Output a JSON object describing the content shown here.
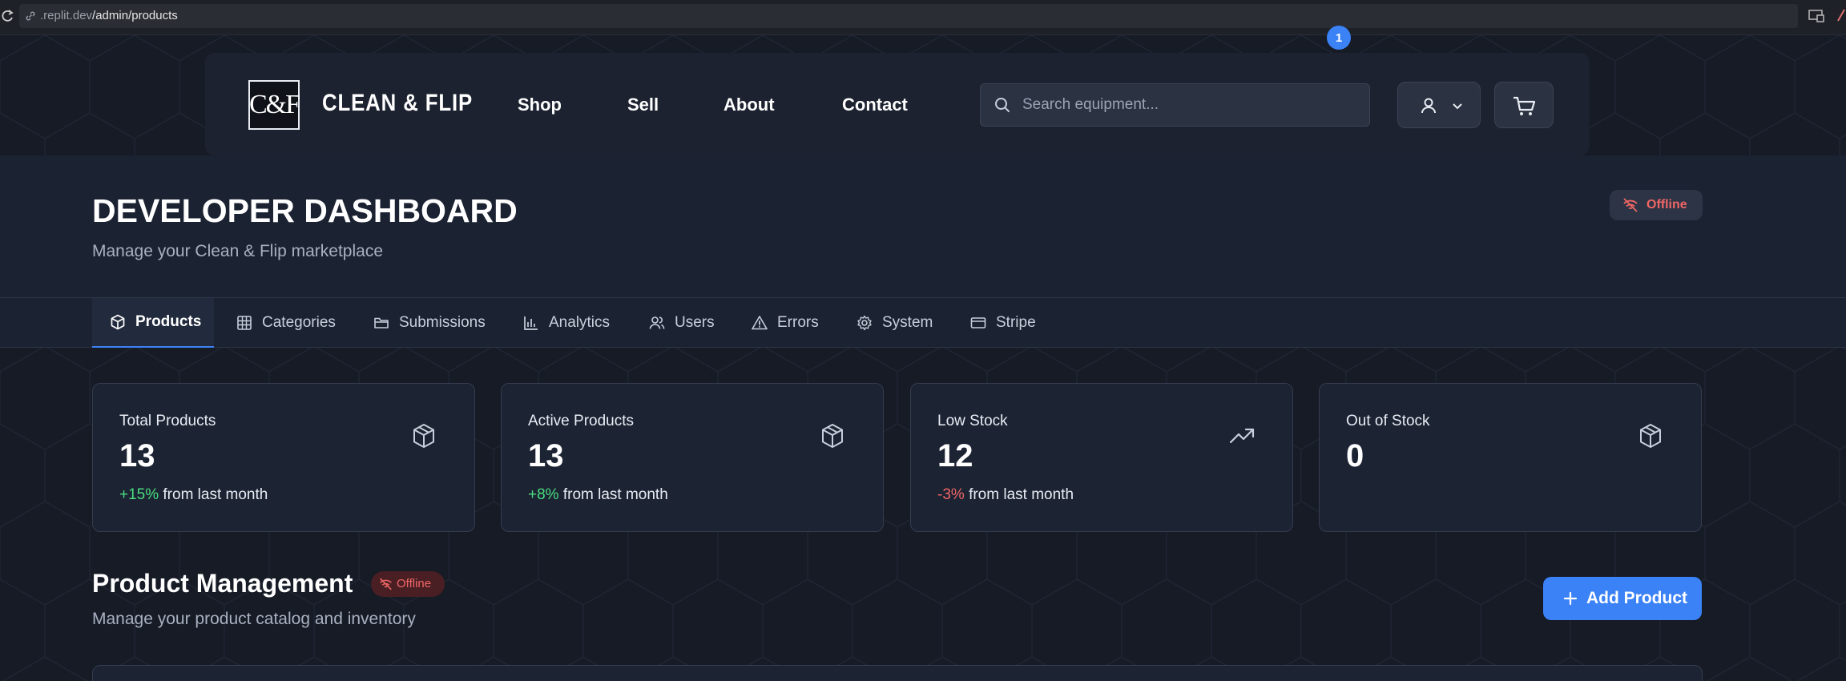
{
  "browser": {
    "url_host": ".replit.dev",
    "url_path": "/admin/products"
  },
  "header": {
    "logo_text": "C&F",
    "brand": "CLEAN & FLIP",
    "nav": [
      "Shop",
      "Sell",
      "About",
      "Contact"
    ],
    "search_placeholder": "Search equipment...",
    "cart_count": "1"
  },
  "dashboard": {
    "title": "DEVELOPER DASHBOARD",
    "subtitle": "Manage your Clean & Flip marketplace",
    "status": "Offline"
  },
  "tabs": [
    {
      "label": "Products",
      "icon": "package-icon",
      "active": true
    },
    {
      "label": "Categories",
      "icon": "grid-icon",
      "active": false
    },
    {
      "label": "Submissions",
      "icon": "folder-icon",
      "active": false
    },
    {
      "label": "Analytics",
      "icon": "bar-chart-icon",
      "active": false
    },
    {
      "label": "Users",
      "icon": "users-icon",
      "active": false
    },
    {
      "label": "Errors",
      "icon": "warning-icon",
      "active": false
    },
    {
      "label": "System",
      "icon": "gear-icon",
      "active": false
    },
    {
      "label": "Stripe",
      "icon": "credit-card-icon",
      "active": false
    }
  ],
  "stats": [
    {
      "label": "Total Products",
      "value": "13",
      "change": "+15%",
      "change_suffix": " from last month",
      "icon": "package-icon"
    },
    {
      "label": "Active Products",
      "value": "13",
      "change": "+8%",
      "change_suffix": " from last month",
      "icon": "package-icon"
    },
    {
      "label": "Low Stock",
      "value": "12",
      "change": "-3%",
      "change_suffix": " from last month",
      "icon": "trending-up-icon"
    },
    {
      "label": "Out of Stock",
      "value": "0",
      "icon": "package-icon"
    }
  ],
  "product_management": {
    "title": "Product Management",
    "status": "Offline",
    "subtitle": "Manage your product catalog and inventory",
    "add_button": "Add Product"
  },
  "colors": {
    "accent": "#3b82f6",
    "positive": "#4ade80",
    "negative": "#f06666",
    "background": "#161b26"
  }
}
